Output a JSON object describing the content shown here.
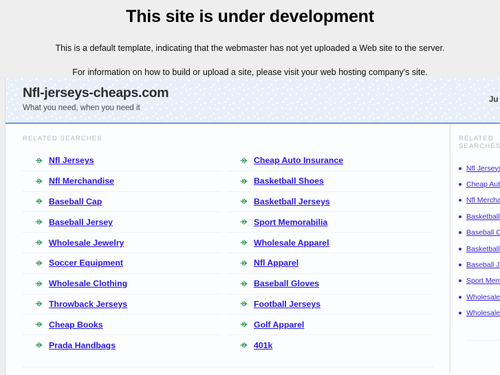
{
  "notice": {
    "title": "This site is under development",
    "line1": "This is a default template, indicating that the webmaster has not yet uploaded a Web site to the server.",
    "line2": "For information on how to build or upload a site, please visit your web hosting company's site."
  },
  "parked": {
    "domain": "Nfl-jerseys-cheaps.com",
    "tagline": "What you need, when you need it",
    "corner_text": "Ju",
    "related_heading": "RELATED SEARCHES",
    "aside_heading": "RELATED SEARCHES",
    "colors": {
      "link": "#2b1ae0",
      "arrow": "#2e9b5a",
      "header_bg": "#e9eff9",
      "header_rule": "#6f97dd",
      "heading_text": "#b9b9b9"
    },
    "column1": [
      "Nfl Jerseys",
      "Nfl Merchandise",
      "Baseball Cap",
      "Baseball Jersey",
      "Wholesale Jewelry",
      "Soccer Equipment",
      "Wholesale Clothing",
      "Throwback Jerseys",
      "Cheap Books",
      "Prada Handbags"
    ],
    "column2": [
      "Cheap Auto Insurance",
      "Basketball Shoes",
      "Basketball Jerseys",
      "Sport Memorabilia",
      "Wholesale Apparel",
      "Nfl Apparel",
      "Baseball Gloves",
      "Football Jerseys",
      "Golf Apparel",
      "401k"
    ],
    "aside_items": [
      "Nfl Jerseys",
      "Cheap Auto Insurance",
      "Nfl Merchandise",
      "Basketball Shoes",
      "Baseball Cap",
      "Basketball Jerseys",
      "Baseball Jersey",
      "Sport Memorabilia",
      "Wholesale Jewelry",
      "Wholesale Apparel"
    ]
  }
}
